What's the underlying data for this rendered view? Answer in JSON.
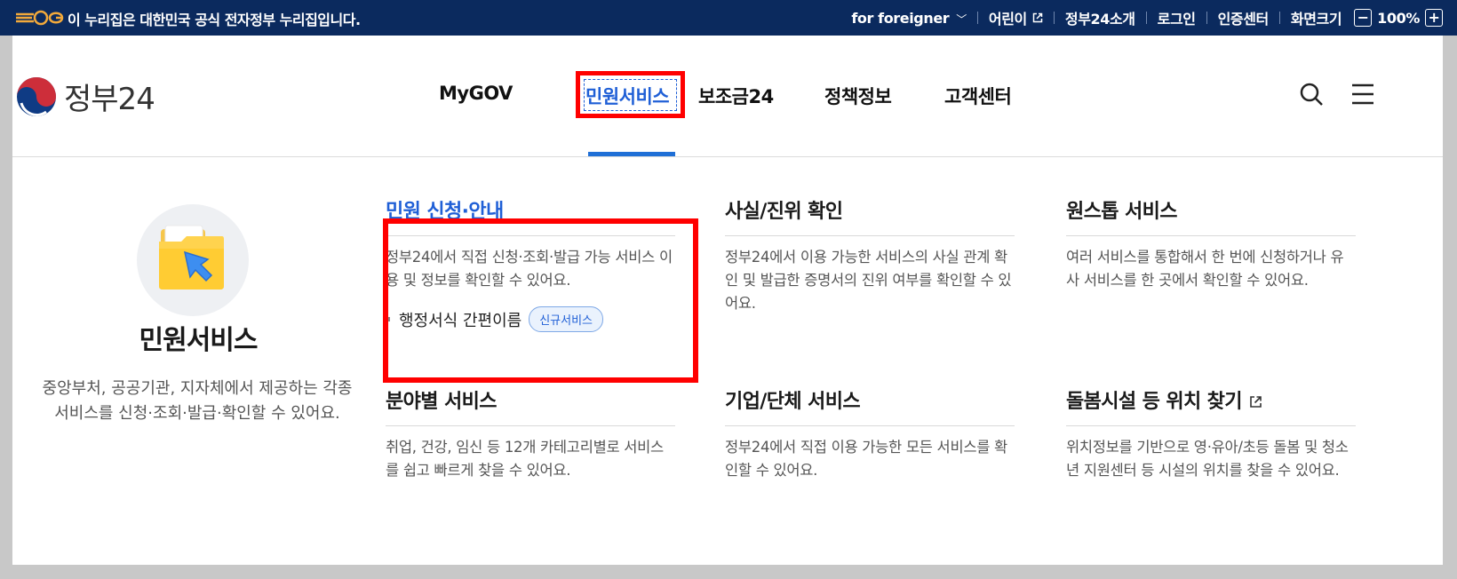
{
  "banner": {
    "official_text": "이 누리집은 대한민국 공식 전자정부 누리집입니다.",
    "links": {
      "foreigner": "for foreigner",
      "kids": "어린이",
      "about": "정부24소개",
      "login": "로그인",
      "cert": "인증센터",
      "font_size": "화면크기"
    },
    "zoom_minus": "−",
    "zoom_value": "100%",
    "zoom_plus": "+"
  },
  "header": {
    "logo_text": "정부24",
    "nav": [
      "MyGOV",
      "민원서비스",
      "보조금24",
      "정책정보",
      "고객센터"
    ],
    "active_nav": "민원서비스"
  },
  "intro": {
    "title": "민원서비스",
    "desc": "중앙부처, 공공기관, 지자체에서 제공하는 각종 서비스를 신청·조회·발급·확인할 수 있어요."
  },
  "cards": [
    {
      "title": "민원 신청·안내",
      "desc": "정부24에서 직접 신청·조회·발급 가능 서비스 이용 및 정보를 확인할 수 있어요.",
      "sub_link": "행정서식 간편이름",
      "badge": "신규서비스"
    },
    {
      "title": "사실/진위 확인",
      "desc": "정부24에서 이용 가능한 서비스의 사실 관계 확인 및 발급한 증명서의 진위 여부를 확인할 수 있어요."
    },
    {
      "title": "원스톱 서비스",
      "desc": "여러 서비스를 통합해서 한 번에 신청하거나 유사 서비스를 한 곳에서 확인할 수 있어요."
    },
    {
      "title": "분야별 서비스",
      "desc": "취업, 건강, 임신 등 12개 카테고리별로 서비스를 쉽고 빠르게 찾을 수 있어요."
    },
    {
      "title": "기업/단체 서비스",
      "desc": "정부24에서 직접 이용 가능한 모든 서비스를 확인할 수 있어요."
    },
    {
      "title": "돌봄시설 등 위치 찾기",
      "desc": "위치정보를 기반으로 영·유아/초등 돌봄 및 청소년 지원센터 등 시설의 위치를 찾을 수 있어요."
    }
  ],
  "colors": {
    "banner_bg": "#0b2a5e",
    "accent_blue": "#1f5fd6",
    "highlight_red": "#ff0000"
  },
  "icons": [
    "emblem-icon",
    "chevron-down-icon",
    "external-link-icon",
    "search-icon",
    "menu-icon",
    "folder-icon",
    "cursor-arrow-icon"
  ]
}
